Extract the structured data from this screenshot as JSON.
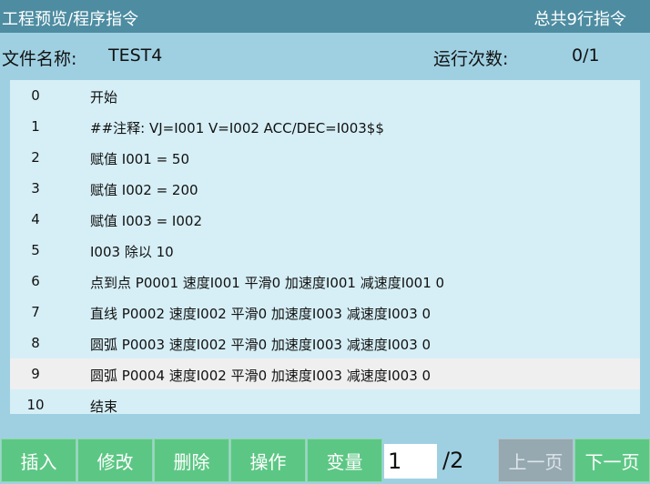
{
  "header": {
    "title": "工程预览/程序指令",
    "total": "总共9行指令"
  },
  "info": {
    "file_label": "文件名称:",
    "file_value": "TEST4",
    "runs_label": "运行次数:",
    "runs_value": "0/1"
  },
  "program": {
    "rows": [
      {
        "num": "0",
        "text": "开始"
      },
      {
        "num": "1",
        "text": "##注释: VJ=I001 V=I002 ACC/DEC=I003$$"
      },
      {
        "num": "2",
        "text": "赋值 I001 = 50"
      },
      {
        "num": "3",
        "text": "赋值 I002 = 200"
      },
      {
        "num": "4",
        "text": "赋值 I003 = I002"
      },
      {
        "num": "5",
        "text": "I003 除以 10"
      },
      {
        "num": "6",
        "text": "点到点 P0001 速度I001  平滑0 加速度I001 减速度I001 0"
      },
      {
        "num": "7",
        "text": "直线 P0002 速度I002  平滑0 加速度I003 减速度I003 0"
      },
      {
        "num": "8",
        "text": "圆弧 P0003 速度I002  平滑0 加速度I003 减速度I003 0"
      },
      {
        "num": "9",
        "text": "圆弧 P0004 速度I002  平滑0 加速度I003 减速度I003 0"
      },
      {
        "num": "10",
        "text": "结束"
      }
    ]
  },
  "toolbar": {
    "insert": "插入",
    "modify": "修改",
    "delete": "删除",
    "operate": "操作",
    "variable": "变量",
    "page_value": "1",
    "page_total": "/2",
    "prev": "上一页",
    "next": "下一页"
  }
}
